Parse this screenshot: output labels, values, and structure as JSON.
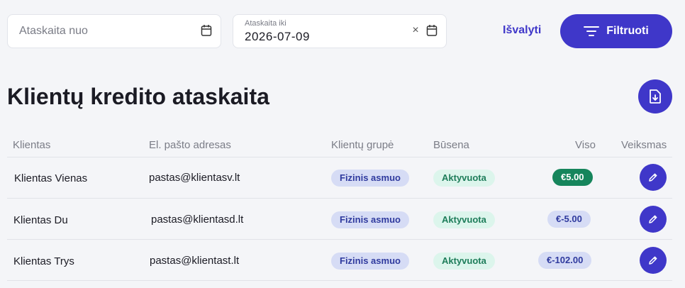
{
  "filters": {
    "date_from": {
      "placeholder": "Ataskaita nuo"
    },
    "date_to": {
      "label": "Ataskaita iki",
      "value": "2026-07-09"
    },
    "clear_label": "Išvalyti",
    "filter_label": "Filtruoti"
  },
  "page": {
    "title": "Klientų kredito ataskaita"
  },
  "table": {
    "headers": {
      "client": "Klientas",
      "email": "El. pašto adresas",
      "group": "Klientų grupė",
      "status": "Būsena",
      "total": "Viso",
      "action": "Veiksmas"
    },
    "rows": [
      {
        "client": "Klientas Vienas",
        "email": "pastas@klientasv.lt",
        "group": "Fizinis asmuo",
        "status": "Aktyvuota",
        "total": "€5.00"
      },
      {
        "client": "Klientas Du",
        "email": "pastas@klientasd.lt",
        "group": "Fizinis asmuo",
        "status": "Aktyvuota",
        "total": "€-5.00"
      },
      {
        "client": "Klientas Trys",
        "email": "pastas@klientast.lt",
        "group": "Fizinis asmuo",
        "status": "Aktyvuota",
        "total": "€-102.00"
      }
    ]
  },
  "icons": {
    "calendar": "calendar-icon",
    "clear": "close-icon",
    "filter": "filter-lines-icon",
    "export": "file-download-icon",
    "edit": "pencil-icon"
  },
  "colors": {
    "accent": "#3f37c9",
    "positive_total": "#16855c",
    "status_bg": "#dcf5ec",
    "group_bg": "#d6dcf5"
  }
}
